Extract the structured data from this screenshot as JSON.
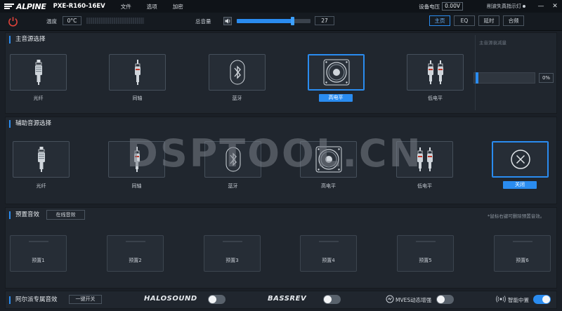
{
  "titlebar": {
    "brand": "ALPINE",
    "model": "PXE-R160-16EV",
    "menu": [
      "文件",
      "选项",
      "加密"
    ],
    "voltage_label": "设备电压",
    "voltage_value": "0.00V",
    "warning": "削波失真指示灯",
    "minimize": "—",
    "close": "✕"
  },
  "controlbar": {
    "temp_label": "温度",
    "temp_value": "0°C",
    "volume_label": "总音量",
    "volume_value": "27",
    "volume_level_percent": 75,
    "tabs": [
      "主页",
      "EQ",
      "延时",
      "合频"
    ],
    "active_tab": 0
  },
  "main_source": {
    "title": "主音源选择",
    "cards": [
      {
        "label": "光纤",
        "icon": "optical-icon"
      },
      {
        "label": "同轴",
        "icon": "coaxial-icon"
      },
      {
        "label": "蓝牙",
        "icon": "bluetooth-icon"
      },
      {
        "label": "高电平",
        "icon": "speaker-icon",
        "selected": true
      },
      {
        "label": "低电平",
        "icon": "rca-icon"
      }
    ],
    "attenuation_label": "主音源衰减量",
    "attenuation_value": "0%",
    "attenuation_level_percent": 0
  },
  "aux_source": {
    "title": "辅助音源选择",
    "cards": [
      {
        "label": "光纤",
        "icon": "optical-icon"
      },
      {
        "label": "同轴",
        "icon": "coaxial-icon"
      },
      {
        "label": "蓝牙",
        "icon": "bluetooth-icon"
      },
      {
        "label": "高电平",
        "icon": "speaker-icon"
      },
      {
        "label": "低电平",
        "icon": "rca-icon"
      },
      {
        "label": "关闭",
        "icon": "close-circle-icon",
        "selected": true
      }
    ]
  },
  "presets": {
    "title": "预置音效",
    "online_button": "在线音效",
    "note": "*鼠标右键可删除预置音效。",
    "items": [
      "预置1",
      "预置2",
      "预置3",
      "预置4",
      "预置5",
      "预置6"
    ]
  },
  "bottom": {
    "title": "阿尔派专属音效",
    "onekey": "一键开关",
    "halo": "HALOSOUND",
    "bassrev": "BASSREV",
    "mves": "MVES动态增强",
    "center": "智能中置",
    "halo_on": false,
    "bassrev_on": false,
    "mves_on": false,
    "center_on": true
  },
  "watermark": "DSPTOOL.CN",
  "colors": {
    "accent": "#2a8cf0",
    "background": "#1a1f26",
    "panel": "#20262e",
    "power": "#e0433a"
  }
}
